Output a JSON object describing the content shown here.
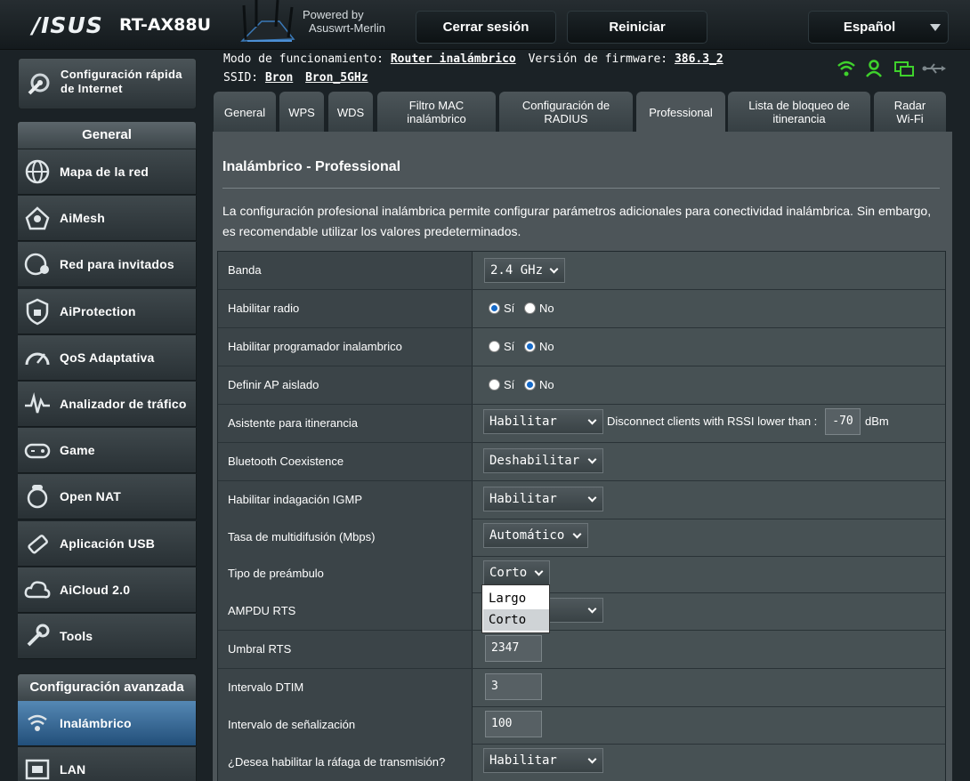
{
  "header": {
    "logo": "/ISUS",
    "model": "RT-AX88U",
    "powered_line1": "Powered by",
    "powered_line2": "Asuswrt-Merlin",
    "logout": "Cerrar sesión",
    "reboot": "Reiniciar",
    "language": "Español"
  },
  "status": {
    "mode_label": "Modo de funcionamiento:",
    "mode_value": "Router inalámbrico",
    "fw_label": "Versión de firmware:",
    "fw_value": "386.3_2",
    "ssid_label": "SSID:",
    "ssid_1": "Bron",
    "ssid_2": "Bron_5GHz",
    "icon_names": [
      "wifi-icon",
      "user-icon",
      "devices-icon",
      "usb-icon"
    ],
    "icon_color": "#3fd22c"
  },
  "sidebar": {
    "quick_setup": [
      "Configuración rápida",
      "de Internet"
    ],
    "general_header": "General",
    "items": [
      {
        "label": "Mapa de la red",
        "icon": "globe-icon"
      },
      {
        "label": "AiMesh",
        "icon": "mesh-icon"
      },
      {
        "label": "Red para invitados",
        "icon": "guest-network-icon"
      },
      {
        "label": "AiProtection",
        "icon": "shield-icon"
      },
      {
        "label": "QoS Adaptativa",
        "icon": "speedometer-icon"
      },
      {
        "label": "Analizador de tráfico",
        "icon": "traffic-icon"
      },
      {
        "label": "Game",
        "icon": "gamepad-icon"
      },
      {
        "label": "Open NAT",
        "icon": "open-nat-icon"
      },
      {
        "label": "Aplicación USB",
        "icon": "usb-app-icon"
      },
      {
        "label": "AiCloud 2.0",
        "icon": "cloud-icon"
      },
      {
        "label": "Tools",
        "icon": "wrench-icon"
      }
    ],
    "advanced_header": "Configuración avanzada",
    "advanced_items": [
      {
        "label": "Inalámbrico",
        "icon": "wireless-icon",
        "active": true
      },
      {
        "label": "LAN",
        "icon": "lan-icon"
      }
    ]
  },
  "tabs": [
    "General",
    "WPS",
    "WDS",
    "Filtro MAC|inalámbrico",
    "Configuración de|RADIUS",
    "Professional",
    "Lista de bloqueo de|itinerancia",
    "Radar|Wi-Fi"
  ],
  "page": {
    "title": "Inalámbrico - Professional",
    "description": "La configuración profesional inalámbrica permite configurar parámetros adicionales para conectividad inalámbrica. Sin embargo, es recomendable utilizar los valores predeterminados."
  },
  "form": {
    "band": {
      "label": "Banda",
      "value": "2.4 GHz"
    },
    "radio": {
      "label": "Habilitar radio",
      "yes": "Sí",
      "no": "No",
      "selected": "yes"
    },
    "scheduler": {
      "label": "Habilitar programador inalambrico",
      "yes": "Sí",
      "no": "No",
      "selected": "no"
    },
    "ap_isolated": {
      "label": "Definir AP aislado",
      "yes": "Sí",
      "no": "No",
      "selected": "no"
    },
    "roaming": {
      "label": "Asistente para itinerancia",
      "value": "Habilitar",
      "rssi_text": "Disconnect clients with RSSI lower than :",
      "rssi_value": "-70",
      "rssi_unit": "dBm"
    },
    "bt": {
      "label": "Bluetooth Coexistence",
      "value": "Deshabilitar"
    },
    "igmp": {
      "label": "Habilitar indagación IGMP",
      "value": "Habilitar"
    },
    "multicast": {
      "label": "Tasa de multidifusión (Mbps)",
      "value": "Automático"
    },
    "preamble": {
      "label": "Tipo de preámbulo",
      "value": "Corto",
      "options": [
        "Largo",
        "Corto"
      ]
    },
    "ampdu": {
      "label": "AMPDU RTS"
    },
    "rts": {
      "label": "Umbral RTS",
      "value": "2347"
    },
    "dtim": {
      "label": "Intervalo DTIM",
      "value": "3"
    },
    "beacon": {
      "label": "Intervalo de señalización",
      "value": "100"
    },
    "burst": {
      "label": "¿Desea habilitar la ráfaga de transmisión?",
      "value": "Habilitar"
    }
  }
}
